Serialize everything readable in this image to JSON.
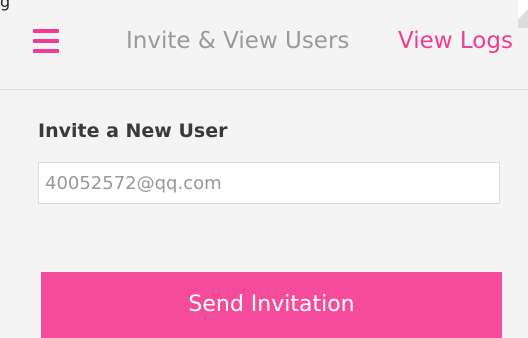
{
  "colors": {
    "accent": "#f03d91",
    "button": "#f54b9b",
    "header_bg": "#f4f4f4",
    "title_gray": "#9a9a9a"
  },
  "corner_glyph": "g",
  "header": {
    "menu_icon": "hamburger-menu-icon",
    "title": "Invite & View Users",
    "link_label": "View Logs"
  },
  "invite": {
    "heading": "Invite a New User",
    "email_value": "40052572@qq.com",
    "send_label": "Send Invitation"
  }
}
